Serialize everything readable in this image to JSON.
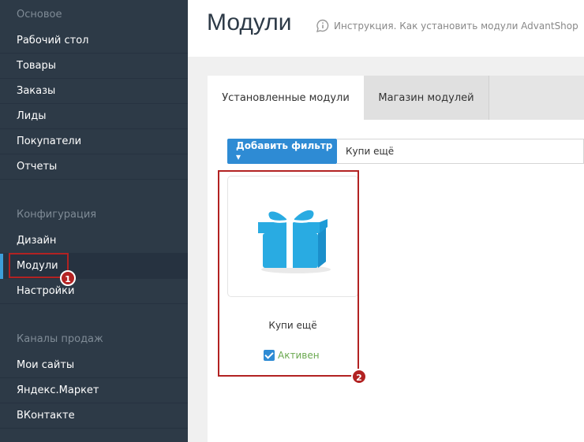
{
  "sidebar": {
    "sections": [
      {
        "label": "Основое"
      },
      {
        "label": "Конфигурация"
      },
      {
        "label": "Каналы продаж"
      }
    ],
    "items": [
      {
        "label": "Рабочий стол"
      },
      {
        "label": "Товары"
      },
      {
        "label": "Заказы"
      },
      {
        "label": "Лиды"
      },
      {
        "label": "Покупатели"
      },
      {
        "label": "Отчеты"
      },
      {
        "label": "Дизайн"
      },
      {
        "label": "Модули"
      },
      {
        "label": "Настройки"
      },
      {
        "label": "Мои сайты"
      },
      {
        "label": "Яндекс.Маркет"
      },
      {
        "label": "ВКонтакте"
      }
    ],
    "active_item": "Модули"
  },
  "header": {
    "title": "Модули",
    "help_text": "Инструкция. Как установить модули AdvantShop",
    "help_icon": "speech-bubble-info-icon"
  },
  "tabs": [
    {
      "label": "Установленные модули"
    },
    {
      "label": "Магазин модулей"
    }
  ],
  "filter": {
    "button_label": "Добавить фильтр ▾",
    "search_value": "Купи ещё"
  },
  "module": {
    "name": "Купи ещё",
    "icon": "gift-box-icon",
    "status_label": "Активен",
    "active": true
  },
  "annotations": [
    {
      "number": "1"
    },
    {
      "number": "2"
    }
  ],
  "colors": {
    "sidebar_bg": "#2d3a47",
    "accent": "#2e8bd4",
    "status_active": "#6aa84f",
    "annotation": "#b22222"
  }
}
